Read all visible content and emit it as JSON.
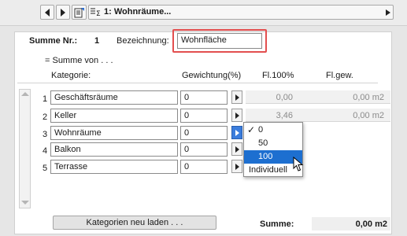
{
  "toolbar": {
    "title": "1: Wohnräume..."
  },
  "header": {
    "summe_nr_label": "Summe Nr.:",
    "summe_nr_value": "1",
    "bezeichnung_label": "Bezeichnung:",
    "bezeichnung_value": "Wohnfläche",
    "summe_von": "= Summe von . . ."
  },
  "columns": {
    "kategorie": "Kategorie:",
    "gewichtung": "Gewichtung(%)",
    "fl100": "Fl.100%",
    "flgew": "Fl.gew."
  },
  "rows": [
    {
      "num": "1",
      "name": "Geschäftsräume",
      "weight": "0",
      "fl100": "0,00",
      "flgew": "0,00 m2"
    },
    {
      "num": "2",
      "name": "Keller",
      "weight": "0",
      "fl100": "3,46",
      "flgew": "0,00 m2"
    },
    {
      "num": "3",
      "name": "Wohnräume",
      "weight": "0",
      "fl100": "",
      "flgew": ""
    },
    {
      "num": "4",
      "name": "Balkon",
      "weight": "0",
      "fl100": "",
      "flgew": ""
    },
    {
      "num": "5",
      "name": "Terrasse",
      "weight": "0",
      "fl100": "",
      "flgew": ""
    }
  ],
  "dropdown": {
    "options": [
      "0",
      "50",
      "100",
      "Individuell"
    ],
    "checked": "0",
    "highlighted": "100"
  },
  "footer": {
    "reload_label": "Kategorien neu laden . . .",
    "summe_label": "Summe:",
    "summe_value": "0,00 m2"
  },
  "colors": {
    "highlight_border": "#e34f4f",
    "menu_selection": "#1d6fd0"
  }
}
